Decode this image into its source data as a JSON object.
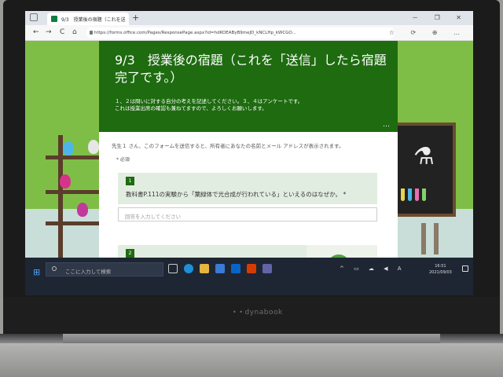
{
  "browser": {
    "tab_title": "9/3　授業後の宿題（これを送",
    "tab_close": "×",
    "new_tab": "+",
    "url": "https://forms.office.com/Pages/ResponsePage.aspx?id=hdKOEAByB9meJD_kNCLHp_kWCGO...",
    "nav_back": "←",
    "nav_forward": "→",
    "nav_refresh": "C",
    "nav_home": "⌂",
    "window_controls": "－ ❐ ✕",
    "toolbar_icons": "☆ ⟳ ⊕ …"
  },
  "form": {
    "title": "9/3　授業後の宿題（これを「送信」したら宿題完了です。）",
    "description": "１、２は問いに対する自分の考えを記述してください。３、４はアンケートです。\nこれは授業出席の確認も兼ねてますので、よろしくお願いします。",
    "more": "…",
    "notice": "先生１ さん、このフォームを送信すると、所有者にあなたの名前とメール アドレスが表示されます。",
    "required_label": "* 必須",
    "q1": {
      "number": "1",
      "text": "教科書P.111の実験から「葉緑体で光合成が行われている」といえるのはなぜか。 *",
      "input_placeholder": "回答を入力してください"
    },
    "q2": {
      "number": "2"
    }
  },
  "taskbar": {
    "start": "⊞",
    "search_placeholder": "ここに入力して検索",
    "tray": "^ ▭ ☁ ◀ A",
    "time": "16:51",
    "date": "2021/09/03"
  },
  "laptop": {
    "brand": "dynabook",
    "brand_dots": "• •"
  },
  "colors": {
    "form_header": "#1e6b10",
    "page_background": "#7fbe46",
    "question_background": "#e2ede1",
    "taskbar": "#1e2633"
  }
}
